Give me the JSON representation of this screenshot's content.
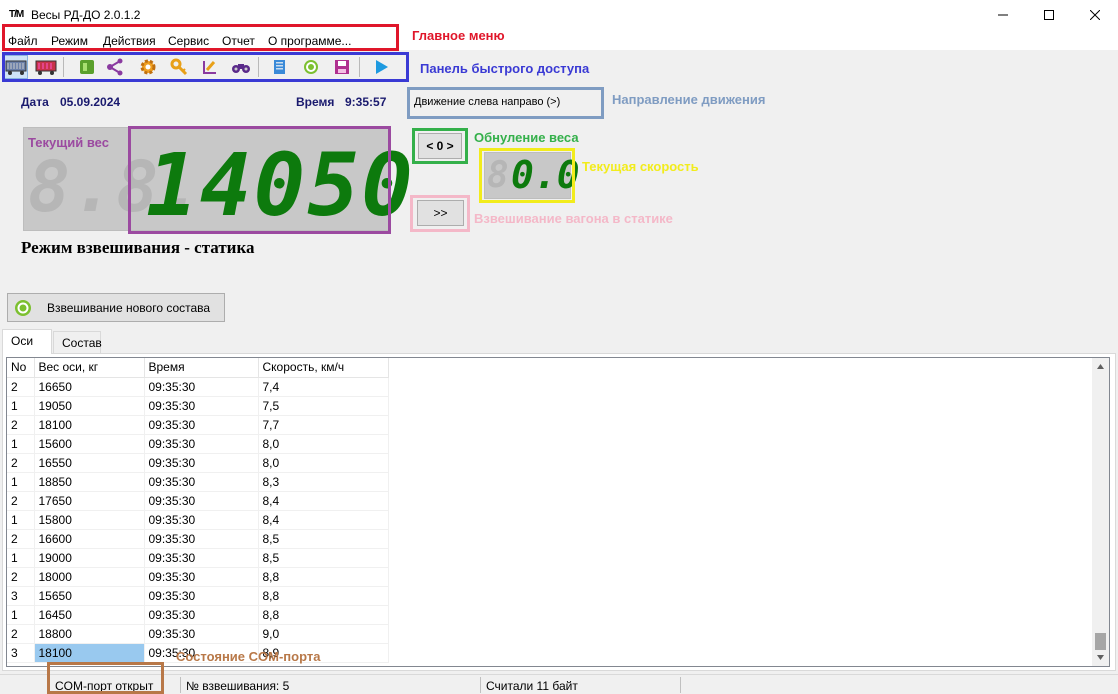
{
  "window": {
    "icon_text": "Т/М",
    "title": "Весы РД-ДО 2.0.1.2"
  },
  "menu": {
    "items": [
      "Файл",
      "Режим",
      "Действия",
      "Сервис",
      "Отчет",
      "О программе..."
    ]
  },
  "toolbar": {
    "icons": [
      "wagon-scale-icon",
      "wagon-icon",
      "book-icon",
      "network-icon",
      "gear-icon",
      "key-icon",
      "edit-chart-icon",
      "binoculars-icon",
      "scroll-icon",
      "refresh-icon",
      "save-icon",
      "play-icon"
    ]
  },
  "annotations": {
    "main_menu": "Главное меню",
    "quick_panel": "Панель быстрого доступа",
    "direction": "Направление движения",
    "zeroing": "Обнуление веса",
    "speed": "Текущая скорость",
    "static_weighing": "Взвешивание вагона в статике",
    "current_weight": "Текущий вес",
    "com_state": "Состояние COM-порта"
  },
  "colors": {
    "menu_box": "#e0162a",
    "toolbar_box": "#3a3ad4",
    "direction_box": "#7f9cc2",
    "zero_box": "#34b04a",
    "speed_box": "#f2ec1c",
    "static_box": "#f4b8c8",
    "weight_box": "#9b4aa0",
    "com_box": "#b87848",
    "lcd_green": "#0d7a0d"
  },
  "info": {
    "date_label": "Дата",
    "date_value": "05.09.2024",
    "time_label": "Время",
    "time_value": "9:35:57",
    "direction": "Движение слева направо (>)"
  },
  "weight": {
    "ghost_digits": "8.8.",
    "value": "14050"
  },
  "speed": {
    "ghost_digit": "8",
    "value": "0.0"
  },
  "buttons": {
    "zero": "< 0 >",
    "static": ">>",
    "new_train": "Взвешивание нового состава"
  },
  "mode_text": "Режим взвешивания - статика",
  "tabs": [
    "Оси",
    "Состав"
  ],
  "table": {
    "headers": [
      "No",
      "Вес оси, кг",
      "Время",
      "Скорость, км/ч"
    ],
    "rows": [
      [
        "2",
        "16650",
        "09:35:30",
        "7,4"
      ],
      [
        "1",
        "19050",
        "09:35:30",
        "7,5"
      ],
      [
        "2",
        "18100",
        "09:35:30",
        "7,7"
      ],
      [
        "1",
        "15600",
        "09:35:30",
        "8,0"
      ],
      [
        "2",
        "16550",
        "09:35:30",
        "8,0"
      ],
      [
        "1",
        "18850",
        "09:35:30",
        "8,3"
      ],
      [
        "2",
        "17650",
        "09:35:30",
        "8,4"
      ],
      [
        "1",
        "15800",
        "09:35:30",
        "8,4"
      ],
      [
        "2",
        "16600",
        "09:35:30",
        "8,5"
      ],
      [
        "1",
        "19000",
        "09:35:30",
        "8,5"
      ],
      [
        "2",
        "18000",
        "09:35:30",
        "8,8"
      ],
      [
        "3",
        "15650",
        "09:35:30",
        "8,8"
      ],
      [
        "1",
        "16450",
        "09:35:30",
        "8,8"
      ],
      [
        "2",
        "18800",
        "09:35:30",
        "9,0"
      ],
      [
        "3",
        "18100",
        "09:35:30",
        "8,9"
      ]
    ]
  },
  "status": {
    "com": "COM-порт открыт",
    "weighing_no": "№ взвешивания: 5",
    "bytes": "Считали 11 байт"
  }
}
